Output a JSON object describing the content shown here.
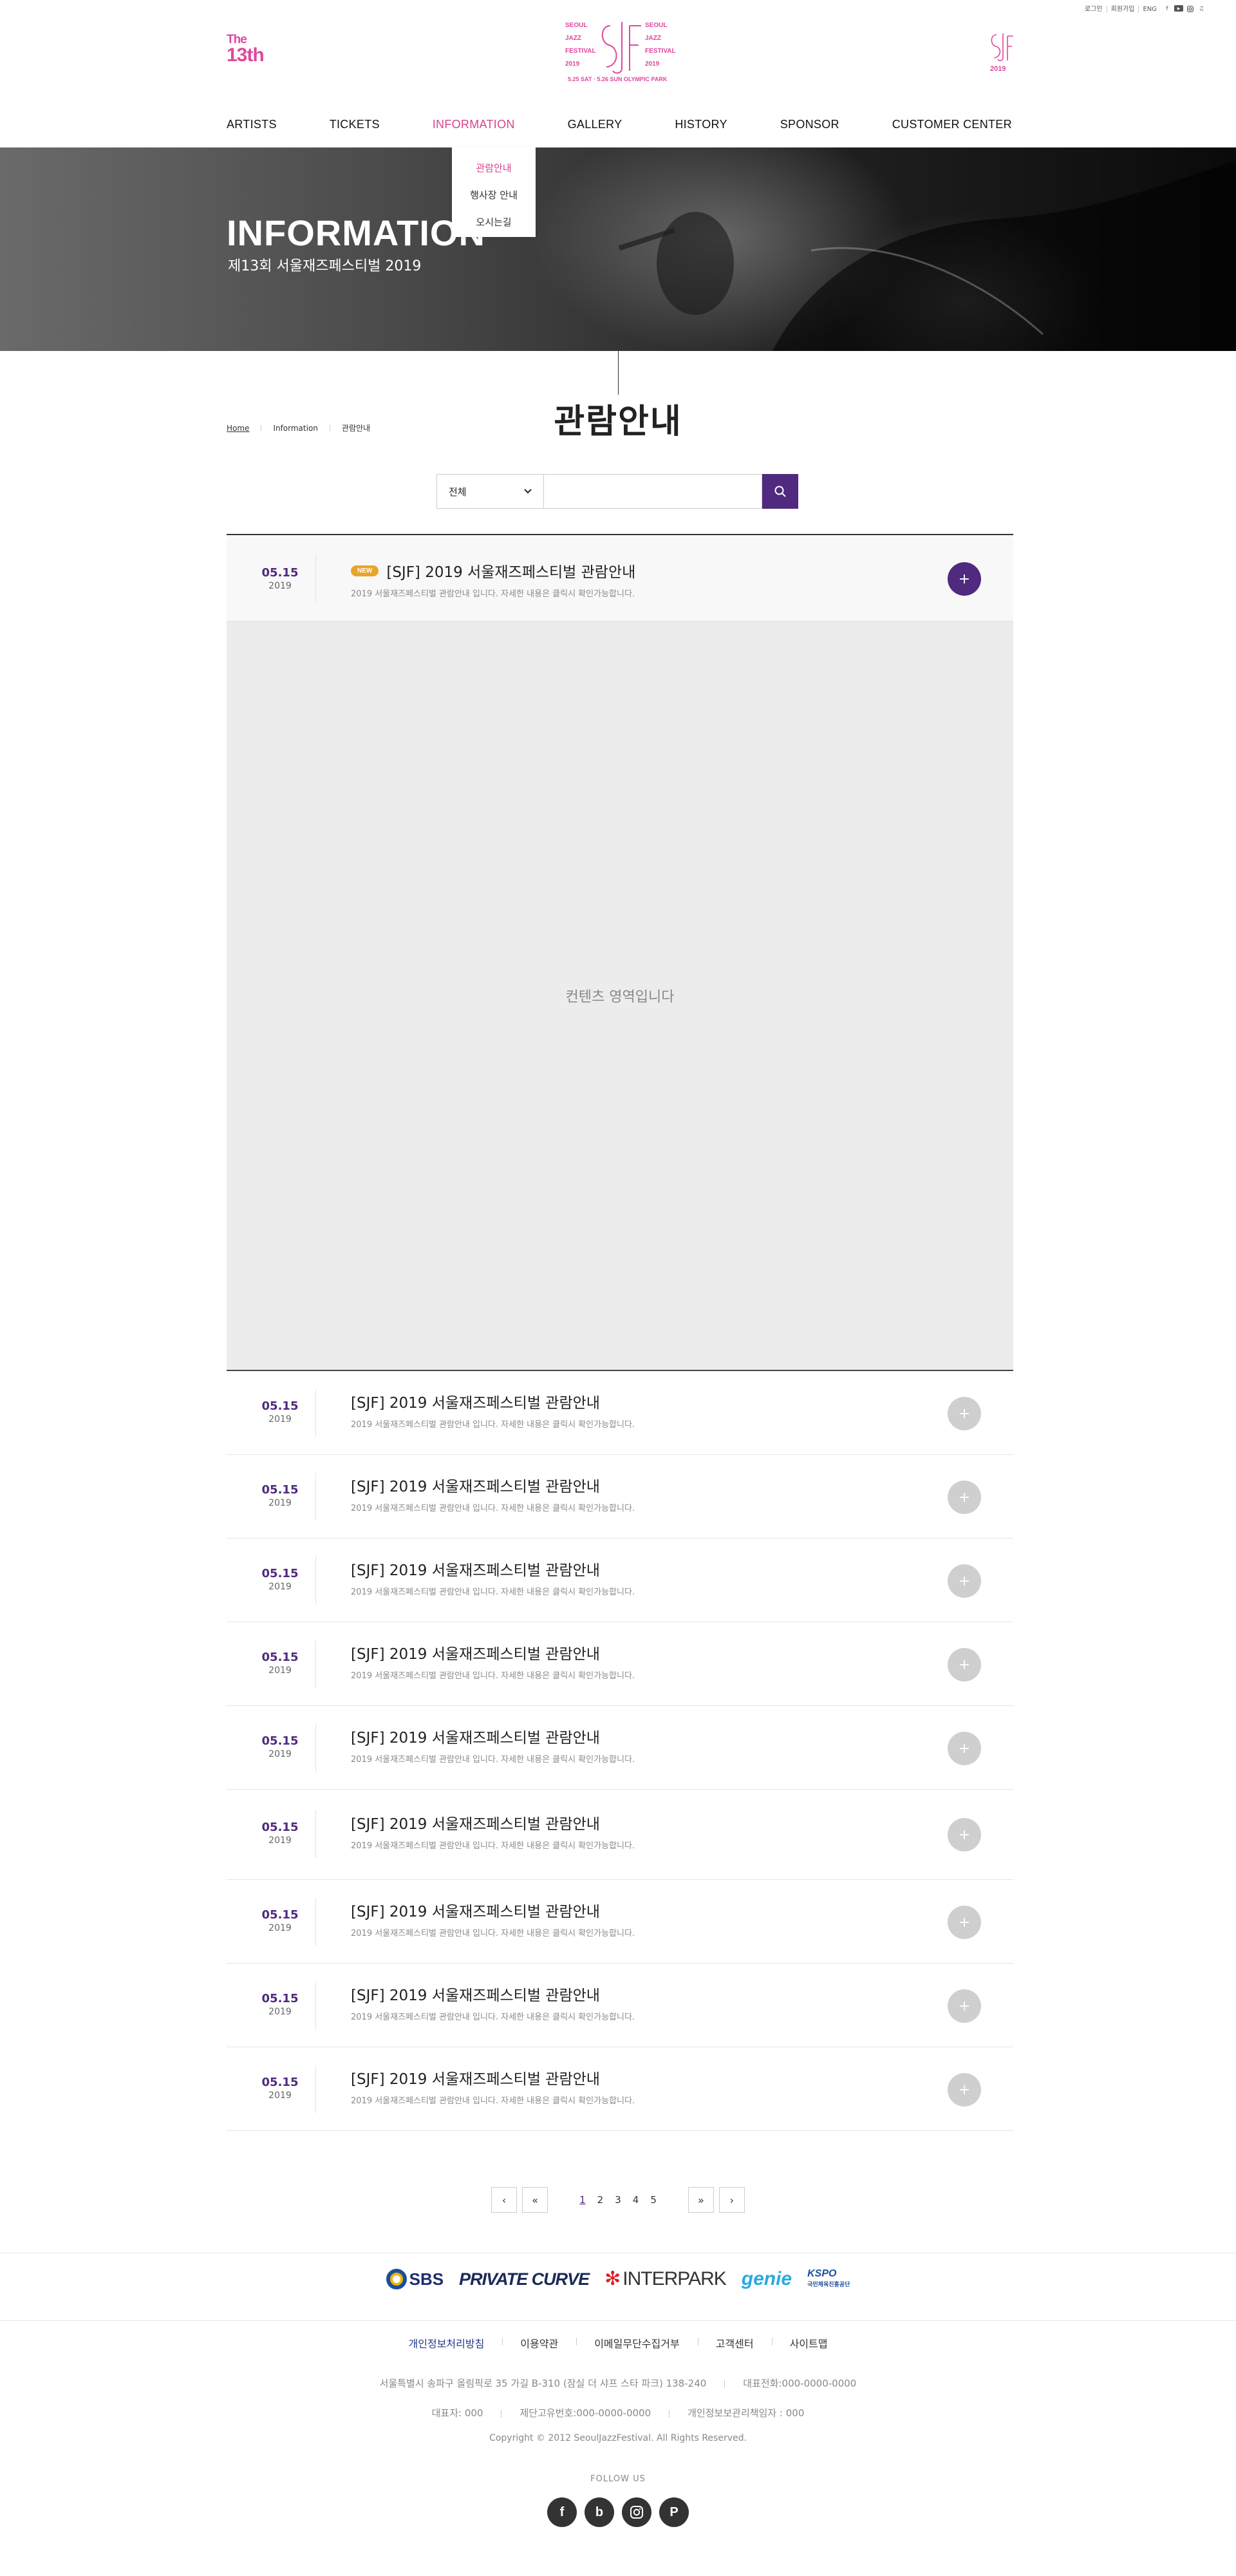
{
  "utility": {
    "login": "로그인",
    "join": "회원가입",
    "lang": "ENG"
  },
  "brand": {
    "the": "The",
    "thirteenth": "13th",
    "logo_left": [
      "SEOUL",
      "JAZZ",
      "FESTIVAL",
      "2019"
    ],
    "logo_right": [
      "SEOUL",
      "JAZZ",
      "FESTIVAL",
      "2019"
    ],
    "logo_date": "5.25 SAT · 5.26 SUN OLYMPIC PARK",
    "right_logo_year": "2019",
    "pink": "#e0479e"
  },
  "nav": {
    "items": [
      {
        "label": "ARTISTS"
      },
      {
        "label": "TICKETS"
      },
      {
        "label": "INFORMATION"
      },
      {
        "label": "GALLERY"
      },
      {
        "label": "HISTORY"
      },
      {
        "label": "SPONSOR"
      },
      {
        "label": "CUSTOMER CENTER"
      }
    ],
    "dropdown": [
      {
        "label": "관람안내"
      },
      {
        "label": "행사장 안내"
      },
      {
        "label": "오시는길"
      }
    ]
  },
  "hero": {
    "title": "INFORMATION",
    "subtitle": "제13회 서울재즈페스티벌 2019"
  },
  "breadcrumb": {
    "home": "Home",
    "section": "Information",
    "page": "관람안내"
  },
  "page_title": "관람안내",
  "search": {
    "select_value": "전체"
  },
  "list": {
    "open_item": {
      "month_day": "05.15",
      "year": "2019",
      "badge": "NEW",
      "title": "[SJF] 2019 서울재즈페스티벌 관람안내",
      "desc": "2019 서울재즈페스티벌 관람안내 입니다. 자세한 내용은 클릭시 확인가능합니다."
    },
    "content_placeholder": "컨텐츠 영역입니다",
    "items": [
      {
        "month_day": "05.15",
        "year": "2019",
        "title": "[SJF] 2019 서울재즈페스티벌 관람안내",
        "desc": "2019 서울재즈페스티벌 관람안내 입니다. 자세한 내용은 클릭시 확인가능합니다."
      },
      {
        "month_day": "05.15",
        "year": "2019",
        "title": "[SJF] 2019 서울재즈페스티벌 관람안내",
        "desc": "2019 서울재즈페스티벌 관람안내 입니다. 자세한 내용은 클릭시 확인가능합니다."
      },
      {
        "month_day": "05.15",
        "year": "2019",
        "title": "[SJF] 2019 서울재즈페스티벌 관람안내",
        "desc": "2019 서울재즈페스티벌 관람안내 입니다. 자세한 내용은 클릭시 확인가능합니다."
      },
      {
        "month_day": "05.15",
        "year": "2019",
        "title": "[SJF] 2019 서울재즈페스티벌 관람안내",
        "desc": "2019 서울재즈페스티벌 관람안내 입니다. 자세한 내용은 클릭시 확인가능합니다."
      },
      {
        "month_day": "05.15",
        "year": "2019",
        "title": "[SJF] 2019 서울재즈페스티벌 관람안내",
        "desc": "2019 서울재즈페스티벌 관람안내 입니다. 자세한 내용은 클릭시 확인가능합니다."
      },
      {
        "month_day": "05.15",
        "year": "2019",
        "title": "[SJF] 2019 서울재즈페스티벌 관람안내",
        "desc": "2019 서울재즈페스티벌 관람안내 입니다. 자세한 내용은 클릭시 확인가능합니다."
      },
      {
        "month_day": "05.15",
        "year": "2019",
        "title": "[SJF] 2019 서울재즈페스티벌 관람안내",
        "desc": "2019 서울재즈페스티벌 관람안내 입니다. 자세한 내용은 클릭시 확인가능합니다."
      },
      {
        "month_day": "05.15",
        "year": "2019",
        "title": "[SJF] 2019 서울재즈페스티벌 관람안내",
        "desc": "2019 서울재즈페스티벌 관람안내 입니다. 자세한 내용은 클릭시 확인가능합니다."
      },
      {
        "month_day": "05.15",
        "year": "2019",
        "title": "[SJF] 2019 서울재즈페스티벌 관람안내",
        "desc": "2019 서울재즈페스티벌 관람안내 입니다. 자세한 내용은 클릭시 확인가능합니다."
      }
    ],
    "accent": "#4f2a7e",
    "badge_color": "#e9a42c"
  },
  "pagination": {
    "pages": [
      "1",
      "2",
      "3",
      "4",
      "5"
    ],
    "current": "1"
  },
  "sponsors": {
    "sbs": "SBS",
    "private_curve": "PRIVATE CURVE",
    "interpark": "INTERPARK",
    "genie": "genie",
    "kspo": "KSPO",
    "kspo_sub": "국민체육진흥공단"
  },
  "footer": {
    "links": [
      {
        "label": "개인정보처리방침"
      },
      {
        "label": "이용약관"
      },
      {
        "label": "이메일무단수집거부"
      },
      {
        "label": "고객센터"
      },
      {
        "label": "사이트맵"
      }
    ],
    "address": "서울특별시 송파구 올림픽로 35 가길 B-310 (잠실 더 샤프 스타 파크) 138-240",
    "phone": "대표전화:000-0000-0000",
    "ceo": "대표자: 000",
    "biz_no": "제단고유번호:000-0000-0000",
    "privacy_officer": "개인정보보관리책임자 : 000",
    "copyright": "Copyright © 2012 SeoulJazzFestival. All Rights Reserved.",
    "follow": "FOLLOW US",
    "social": [
      "f",
      "b",
      "instagram",
      "p"
    ]
  }
}
